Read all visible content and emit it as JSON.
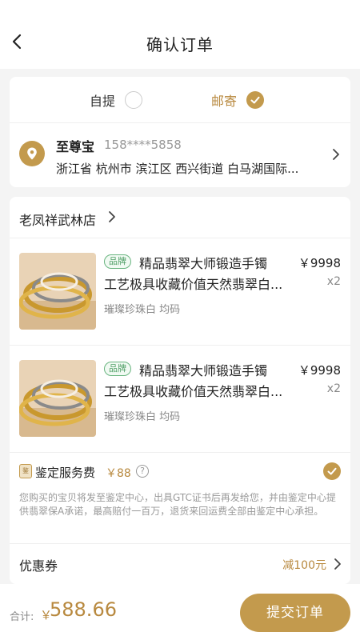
{
  "header": {
    "title": "确认订单",
    "back_icon": "chevron-left-icon"
  },
  "delivery": {
    "options": [
      {
        "label": "自提",
        "selected": false
      },
      {
        "label": "邮寄",
        "selected": true
      }
    ]
  },
  "address": {
    "name": "至尊宝",
    "phone": "158****5858",
    "detail": "浙江省 杭州市 滨江区 西兴街道 白马湖国际..."
  },
  "store": {
    "name": "老凤祥武林店"
  },
  "products": [
    {
      "brand_tag": "品牌",
      "title_line1": "精品翡翠大师锻造手镯",
      "title_line2": "工艺极具收藏价值天然翡翠白...",
      "spec": "璀璨珍珠白   均码",
      "price": "￥9998",
      "qty": "x2"
    },
    {
      "brand_tag": "品牌",
      "title_line1": "精品翡翠大师锻造手镯",
      "title_line2": "工艺极具收藏价值天然翡翠白...",
      "spec": "璀璨珍珠白   均码",
      "price": "￥9998",
      "qty": "x2"
    }
  ],
  "service": {
    "icon_text": "鉴",
    "label": "鉴定服务费",
    "price": "￥88",
    "help": "?",
    "checked": true,
    "description": "您购买的宝贝将发至鉴定中心，出具GTC证书后再发给您，并由鉴定中心提供翡翠保A承诺，最高赔付一百万，退货来回运费全部由鉴定中心承担。"
  },
  "coupon": {
    "label": "优惠券",
    "value": "减100元"
  },
  "footer": {
    "total_label": "合计:",
    "currency": "￥",
    "amount": "588.66",
    "submit": "提交订单"
  },
  "colors": {
    "accent": "#c39a4d",
    "accent_text": "#b8893f",
    "brand_green": "#4e9e65",
    "background": "#f4f4f4"
  }
}
